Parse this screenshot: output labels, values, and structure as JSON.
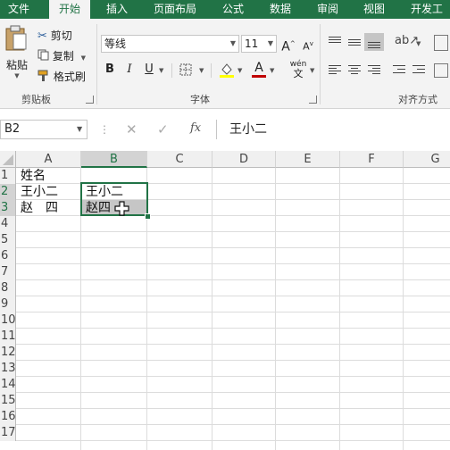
{
  "ribbon_tabs": [
    "文件",
    "开始",
    "插入",
    "页面布局",
    "公式",
    "数据",
    "审阅",
    "视图",
    "开发工"
  ],
  "active_tab": "开始",
  "clipboard": {
    "paste_label": "粘贴",
    "cut_label": "剪切",
    "copy_label": "复制",
    "format_painter_label": "格式刷",
    "group_label": "剪贴板"
  },
  "font": {
    "name": "等线",
    "size": "11",
    "group_label": "字体",
    "grow_label": "A",
    "shrink_label": "A",
    "bold_label": "B",
    "italic_label": "I",
    "underline_label": "U",
    "font_color_label": "A",
    "phonetic_label": "wén",
    "phonetic_sub": "文"
  },
  "alignment": {
    "group_label": "对齐方式"
  },
  "formula_bar": {
    "name_box": "B2",
    "fx_label": "fx",
    "content": "王小二"
  },
  "columns": [
    "A",
    "B",
    "C",
    "D",
    "E",
    "F",
    "G"
  ],
  "selected_column": "B",
  "rows": [
    "1",
    "2",
    "3",
    "4",
    "5",
    "6",
    "7",
    "8",
    "9",
    "10",
    "11",
    "12",
    "13",
    "14",
    "15",
    "16",
    "17"
  ],
  "selected_rows": [
    "2",
    "3"
  ],
  "cells": {
    "A1": "姓名",
    "A2": "王小二",
    "A3": "赵　四",
    "B2": "王小二",
    "B3": "赵四"
  },
  "colors": {
    "accent": "#217346",
    "highlight_fill": "#ffff00",
    "font_color": "#c00000",
    "selection_fill": "#c6c6c6"
  }
}
